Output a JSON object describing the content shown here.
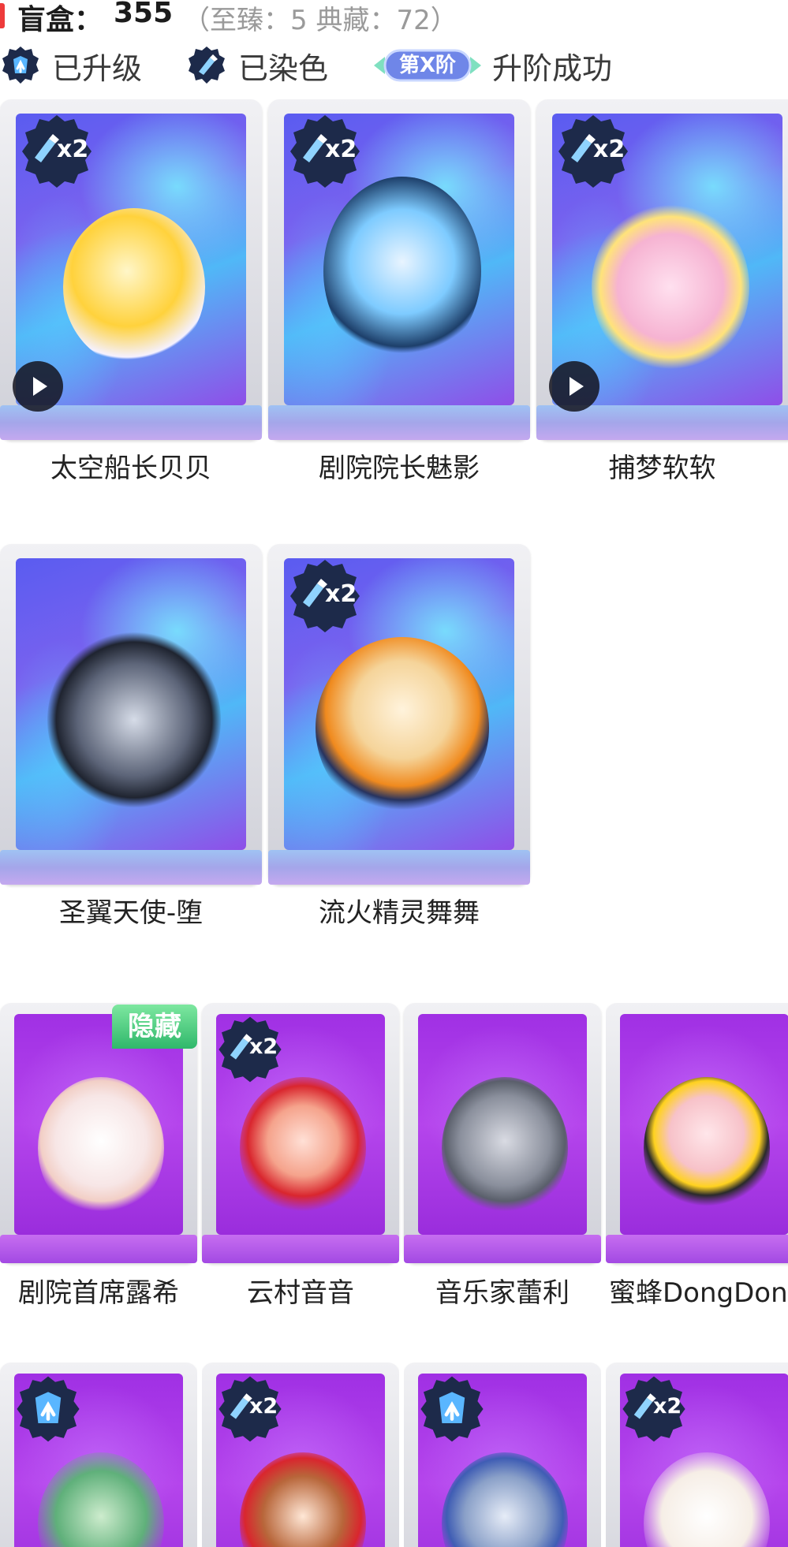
{
  "header": {
    "title": "盲盒：",
    "count": "355",
    "sub": "（至臻：5 典藏：72）"
  },
  "legend": {
    "upgraded": "已升级",
    "dyed": "已染色",
    "tier_pill": "第X阶",
    "tier_success": "升阶成功"
  },
  "badges": {
    "dye_multiplier": "x2",
    "hidden": "隐藏"
  },
  "rows": [
    {
      "items": [
        {
          "name": "太空船长贝贝",
          "badge": "dye",
          "play": true
        },
        {
          "name": "剧院院长魅影",
          "badge": "dye",
          "play": false
        },
        {
          "name": "捕梦软软",
          "badge": "dye",
          "play": true
        }
      ]
    },
    {
      "items": [
        {
          "name": "圣翼天使-堕",
          "badge": "none",
          "play": false
        },
        {
          "name": "流火精灵舞舞",
          "badge": "dye",
          "play": false
        }
      ]
    },
    {
      "items": [
        {
          "name": "剧院首席露希",
          "badge": "hidden"
        },
        {
          "name": "云村音音",
          "badge": "dye"
        },
        {
          "name": "音乐家蕾利",
          "badge": "none"
        },
        {
          "name": "蜜蜂DongDong",
          "badge": "none"
        }
      ]
    },
    {
      "items": [
        {
          "badge": "upgrade"
        },
        {
          "badge": "dye"
        },
        {
          "badge": "upgrade"
        },
        {
          "badge": "dye"
        }
      ]
    }
  ],
  "colors": {
    "accent_bar": "#ee3b3b",
    "hidden_tag": "#2fb86b",
    "blue_panel": "#5a5cf0",
    "purple_panel": "#a030e4"
  }
}
